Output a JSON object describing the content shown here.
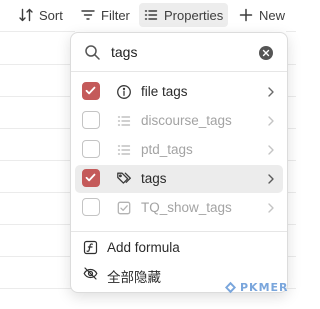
{
  "toolbar": {
    "sort_label": "Sort",
    "filter_label": "Filter",
    "properties_label": "Properties",
    "new_label": "New"
  },
  "search": {
    "value": "tags",
    "placeholder": "",
    "icon": "search-icon",
    "clear_icon": "clear-icon"
  },
  "properties": [
    {
      "label": "file tags",
      "checked": true,
      "enabled": true,
      "icon": "info-icon"
    },
    {
      "label": "discourse_tags",
      "checked": false,
      "enabled": false,
      "icon": "list-icon"
    },
    {
      "label": "ptd_tags",
      "checked": false,
      "enabled": false,
      "icon": "list-icon"
    },
    {
      "label": "tags",
      "checked": true,
      "enabled": true,
      "icon": "tags-icon",
      "hovered": true
    },
    {
      "label": "TQ_show_tags",
      "checked": false,
      "enabled": false,
      "icon": "checkbox-icon"
    }
  ],
  "actions": {
    "add_formula": "Add formula",
    "hide_all": "全部隐藏"
  },
  "watermark": {
    "text": "PKMER"
  },
  "colors": {
    "accent": "#c45a5a",
    "panel_border": "#dcdcdc",
    "hover_bg": "#ececec",
    "muted_text": "#a3a3a3",
    "watermark": "#7aa6dc"
  }
}
